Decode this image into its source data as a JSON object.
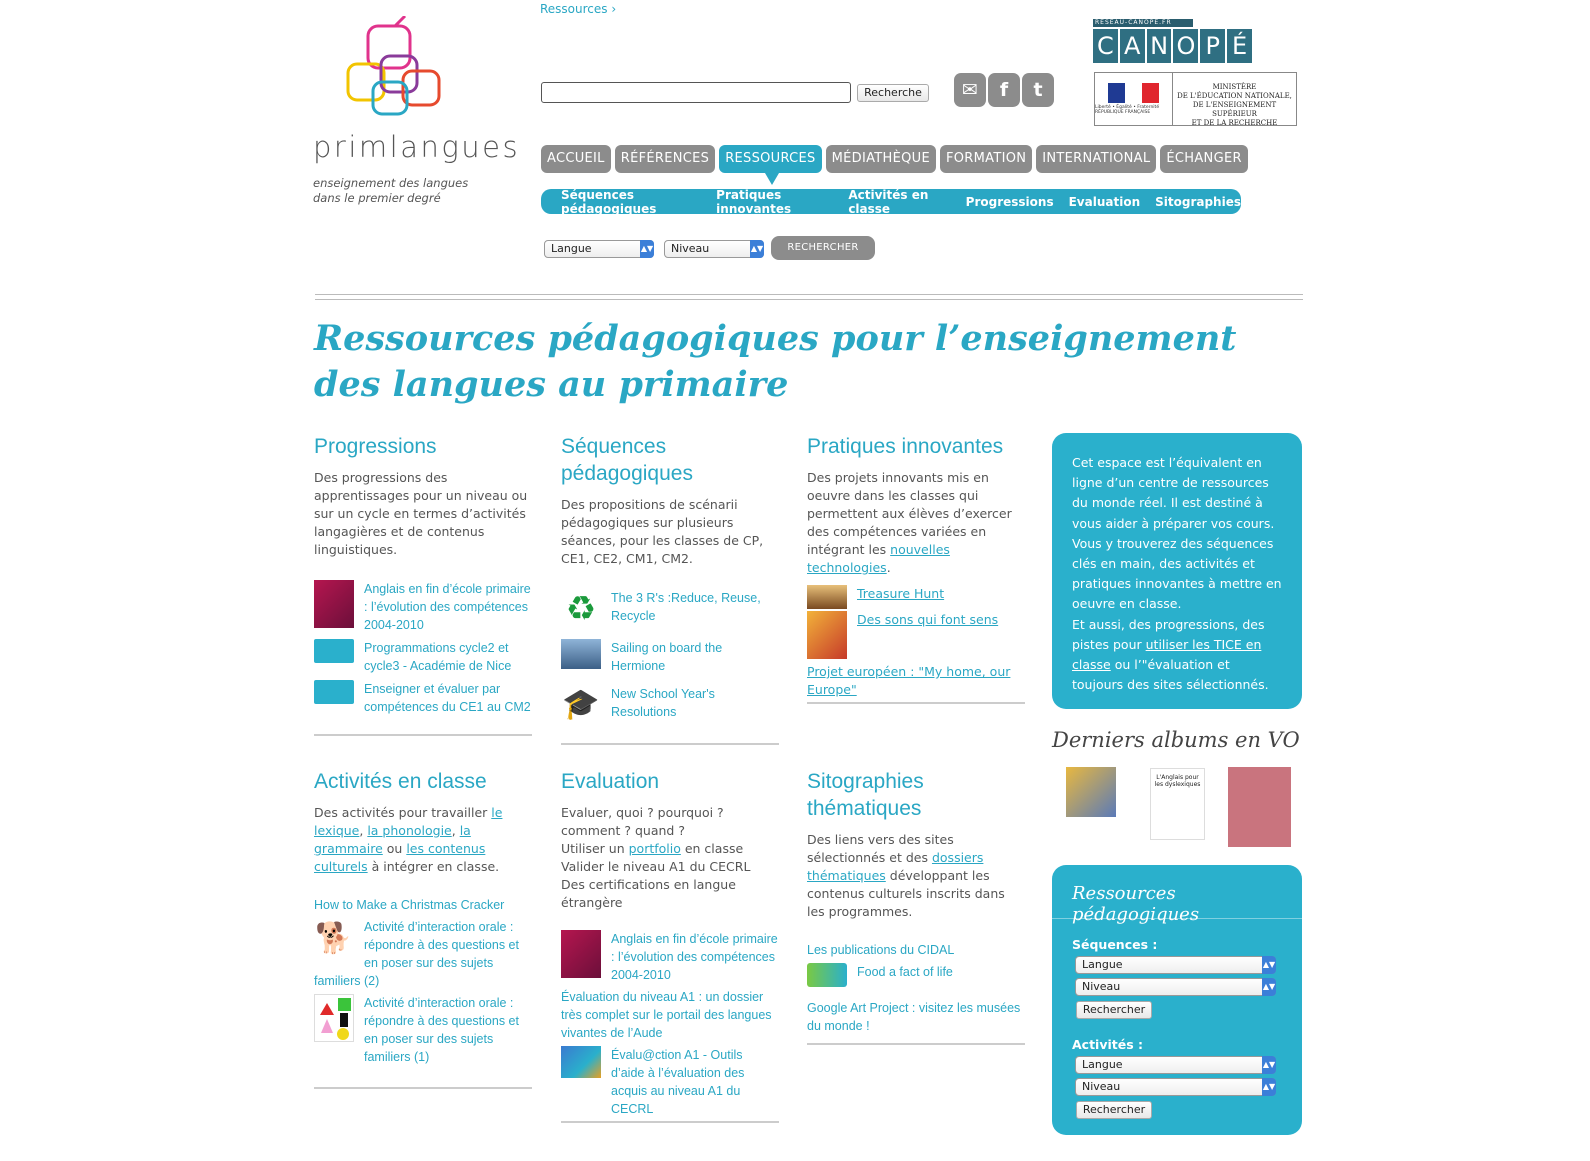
{
  "header": {
    "breadcrumb": "Ressources ›",
    "logo_word": "primlangues",
    "logo_tagline_1": "enseignement des langues",
    "logo_tagline_2": "dans le premier degré",
    "search_value": "",
    "search_button": "Recherche",
    "canope_small": "RÉSEAU-CANOPÉ.FR",
    "canope_letters": [
      "C",
      "A",
      "N",
      "O",
      "P",
      "É"
    ],
    "flag_motto": "Liberté • Égalité • Fraternité RÉPUBLIQUE FRANÇAISE",
    "ministere_1": "MINISTÈRE",
    "ministere_2": "DE L'ÉDUCATION NATIONALE,",
    "ministere_3": "DE L'ENSEIGNEMENT SUPÉRIEUR",
    "ministere_4": "ET DE LA RECHERCHE"
  },
  "nav": {
    "tabs": [
      "ACCUEIL",
      "RÉFÉRENCES",
      "RESSOURCES",
      "MÉDIATHÈQUE",
      "FORMATION",
      "INTERNATIONAL",
      "ÉCHANGER"
    ],
    "subtabs": [
      "Séquences pédagogiques",
      "Pratiques innovantes",
      "Activités en classe",
      "Progressions",
      "Evaluation",
      "Sitographies"
    ]
  },
  "filter": {
    "langue": "Langue",
    "niveau": "Niveau",
    "button": "RECHERCHER"
  },
  "page_title": "Ressources pédagogiques pour l’enseignement des langues au primaire",
  "progressions": {
    "title": "Progressions",
    "desc": "Des progressions des apprentissages pour un niveau ou sur un cycle en termes d’activités langagières et de contenus linguistiques.",
    "items": [
      "Anglais en fin d’école primaire : l’évolution des compétences 2004-2010",
      "Programmations cycle2 et cycle3 - Académie de Nice",
      "Enseigner et évaluer par compétences du CE1 au CM2"
    ]
  },
  "sequences": {
    "title": "Séquences pédagogiques",
    "desc": "Des propositions de scénarii pédagogiques sur plusieurs séances, pour les classes de CP, CE1, CE2, CM1, CM2.",
    "items": [
      "The 3 R's :Reduce, Reuse, Recycle",
      "Sailing on board the Hermione",
      "New School Year's Resolutions"
    ]
  },
  "pratiques": {
    "title": "Pratiques innovantes",
    "desc_before": "Des projets innovants mis en oeuvre dans les classes qui permettent aux élèves d’exercer des compétences variées en intégrant les ",
    "desc_link": "nouvelles technologies",
    "desc_after": ".",
    "items": [
      "Treasure Hunt",
      "Des sons qui font sens"
    ],
    "extra_link": "Projet européen : \"My home, our Europe\""
  },
  "activites": {
    "title": "Activités en classe",
    "desc_1": "Des activités pour travailler ",
    "link_1": "le lexique",
    "sep_1": ", ",
    "link_2": "la phonologie",
    "sep_2": ", ",
    "link_3": "la grammaire",
    "sep_3": " ou ",
    "link_4": "les contenus culturels",
    "desc_2": " à intégrer en classe.",
    "top_link": "How to Make a Christmas Cracker",
    "items": [
      "Activité d’interaction orale : répondre à des questions et en poser sur des sujets familiers (2)",
      "Activité d’interaction orale : répondre à des questions et en poser sur des sujets familiers (1)"
    ]
  },
  "evaluation": {
    "title": "Evaluation",
    "line_1": "Evaluer, quoi ? pourquoi ? comment ? quand ?",
    "line_2_before": "Utiliser un ",
    "line_2_link": "portfolio",
    "line_2_after": " en classe",
    "line_3": "Valider le niveau A1 du CECRL",
    "line_4": "Des certifications en langue étrangère",
    "item_1": "Anglais en fin d’école primaire : l’évolution des compétences 2004-2010",
    "plain": "Évaluation du niveau A1 : un dossier très complet sur le portail des langues vivantes de l’Aude",
    "item_2": "Évalu@ction A1 - Outils d’aide à l’évaluation des acquis au niveau A1 du CECRL"
  },
  "sitographies": {
    "title": "Sitographies thématiques",
    "desc_before": "Des liens vers des sites sélectionnés et des ",
    "desc_link": "dossiers thématiques",
    "desc_after": " développant les contenus culturels inscrits dans les programmes.",
    "top_link": "Les publications du CIDAL",
    "item": "Food a fact of life",
    "bottom_link": "Google Art Project : visitez les musées du monde !"
  },
  "sidebar": {
    "info_1": "Cet espace est l’équivalent en ligne d’un centre de ressources du monde réel. Il est destiné à vous aider à préparer vos cours.",
    "info_2": "Vous y trouverez des séquences clés en main, des activités et pratiques innovantes à mettre en oeuvre en classe.",
    "info_3_before": "Et aussi, des progressions, des pistes pour ",
    "info_3_link": "utiliser les TICE en classe",
    "info_3_after": " ou l’\"évaluation et toujours des sites sélectionnés.",
    "albums_title": "Derniers albums en VO",
    "album_2_title": "L'Anglais pour les dyslexiques",
    "res_title": "Ressources pédagogiques",
    "seq_label": "Séquences :",
    "act_label": "Activités :",
    "langue": "Langue",
    "niveau": "Niveau",
    "button": "Rechercher"
  },
  "colors": {
    "accent": "#2aa7c4",
    "tab_gray": "#8c8c8c",
    "text": "#555555"
  }
}
